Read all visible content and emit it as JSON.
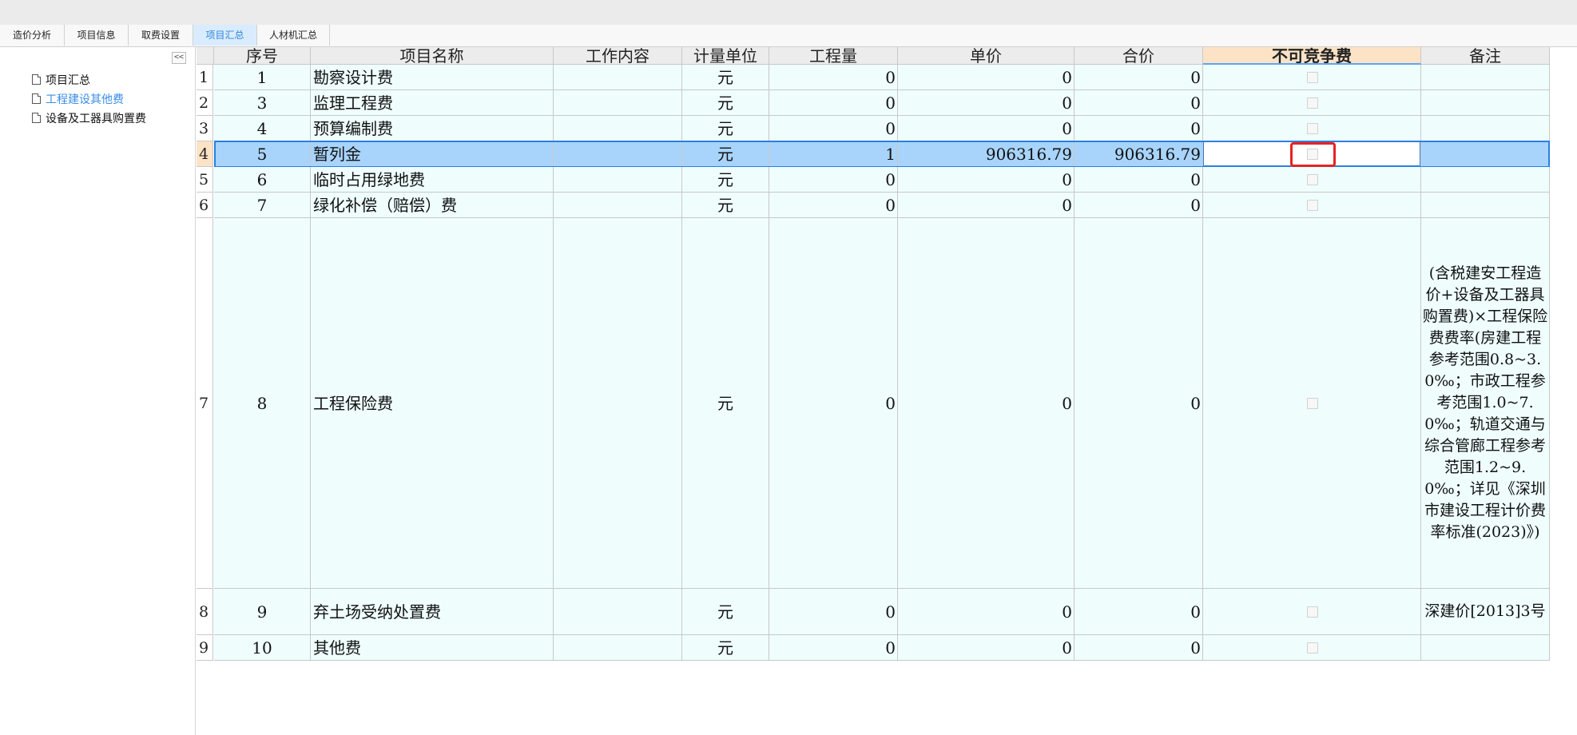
{
  "tabs": [
    {
      "label": "造价分析",
      "active": false
    },
    {
      "label": "项目信息",
      "active": false
    },
    {
      "label": "取费设置",
      "active": false
    },
    {
      "label": "项目汇总",
      "active": true
    },
    {
      "label": "人材机汇总",
      "active": false
    }
  ],
  "sidebar": {
    "collapse_label": "<<",
    "items": [
      {
        "label": "项目汇总",
        "active": false
      },
      {
        "label": "工程建设其他费",
        "active": true
      },
      {
        "label": "设备及工器具购置费",
        "active": false
      }
    ]
  },
  "table": {
    "headers": [
      "序号",
      "项目名称",
      "工作内容",
      "计量单位",
      "工程量",
      "单价",
      "合价",
      "不可竞争费",
      "备注"
    ],
    "rows": [
      {
        "rownum": "1",
        "seq": "1",
        "name": "勘察设计费",
        "content": "",
        "unit": "元",
        "qty": "0",
        "price": "0",
        "total": "0",
        "non_compete": false,
        "note": ""
      },
      {
        "rownum": "2",
        "seq": "3",
        "name": "监理工程费",
        "content": "",
        "unit": "元",
        "qty": "0",
        "price": "0",
        "total": "0",
        "non_compete": false,
        "note": ""
      },
      {
        "rownum": "3",
        "seq": "4",
        "name": "预算编制费",
        "content": "",
        "unit": "元",
        "qty": "0",
        "price": "0",
        "total": "0",
        "non_compete": false,
        "note": ""
      },
      {
        "rownum": "4",
        "seq": "5",
        "name": "暂列金",
        "content": "",
        "unit": "元",
        "qty": "1",
        "price": "906316.79",
        "total": "906316.79",
        "non_compete": false,
        "note": "",
        "selected": true
      },
      {
        "rownum": "5",
        "seq": "6",
        "name": "临时占用绿地费",
        "content": "",
        "unit": "元",
        "qty": "0",
        "price": "0",
        "total": "0",
        "non_compete": false,
        "note": ""
      },
      {
        "rownum": "6",
        "seq": "7",
        "name": "绿化补偿（赔偿）费",
        "content": "",
        "unit": "元",
        "qty": "0",
        "price": "0",
        "total": "0",
        "non_compete": false,
        "note": ""
      },
      {
        "rownum": "7",
        "seq": "8",
        "name": "工程保险费",
        "content": "",
        "unit": "元",
        "qty": "0",
        "price": "0",
        "total": "0",
        "non_compete": false,
        "note": "(含税建安工程造价+设备及工器具购置费)×工程保险费费率(房建工程参考范围0.8~3.0‰；市政工程参考范围1.0~7.0‰；轨道交通与综合管廊工程参考范围1.2~9.0‰；详见《深圳市建设工程计价费率标准(2023)》)"
      },
      {
        "rownum": "8",
        "seq": "9",
        "name": "弃土场受纳处置费",
        "content": "",
        "unit": "元",
        "qty": "0",
        "price": "0",
        "total": "0",
        "non_compete": false,
        "note": "深建价[2013]3号"
      },
      {
        "rownum": "9",
        "seq": "10",
        "name": "其他费",
        "content": "",
        "unit": "元",
        "qty": "0",
        "price": "0",
        "total": "0",
        "non_compete": false,
        "note": ""
      }
    ]
  }
}
